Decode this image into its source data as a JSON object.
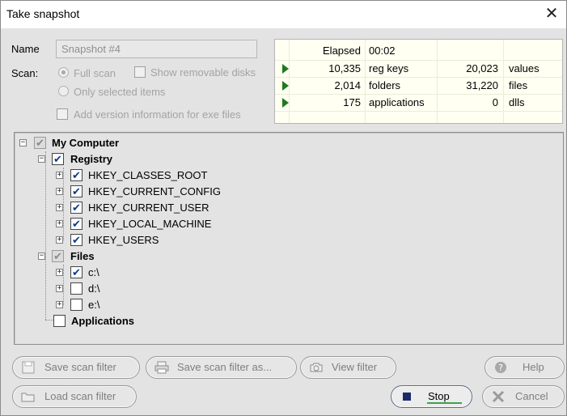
{
  "window": {
    "title": "Take snapshot"
  },
  "form": {
    "name_label": "Name",
    "name_value": "Snapshot #4",
    "scan_label": "Scan:",
    "full_scan": "Full scan",
    "only_selected": "Only selected items",
    "show_removable": "Show removable disks",
    "add_version": "Add version information for exe files"
  },
  "stats": {
    "elapsed_label": "Elapsed",
    "elapsed_value": "00:02",
    "rows": [
      {
        "count": "10,335",
        "label": "reg keys",
        "count2": "20,023",
        "label2": "values"
      },
      {
        "count": "2,014",
        "label": "folders",
        "count2": "31,220",
        "label2": "files"
      },
      {
        "count": "175",
        "label": "applications",
        "count2": "0",
        "label2": "dlls"
      }
    ]
  },
  "tree": {
    "root": "My Computer",
    "registry": "Registry",
    "keys": [
      "HKEY_CLASSES_ROOT",
      "HKEY_CURRENT_CONFIG",
      "HKEY_CURRENT_USER",
      "HKEY_LOCAL_MACHINE",
      "HKEY_USERS"
    ],
    "files": "Files",
    "drives": [
      "c:\\",
      "d:\\",
      "e:\\"
    ],
    "applications": "Applications"
  },
  "buttons": {
    "save_filter": "Save scan filter",
    "save_filter_as": "Save scan filter as...",
    "view_filter": "View filter",
    "help": "Help",
    "load_filter": "Load scan filter",
    "stop": "Stop",
    "cancel": "Cancel"
  }
}
